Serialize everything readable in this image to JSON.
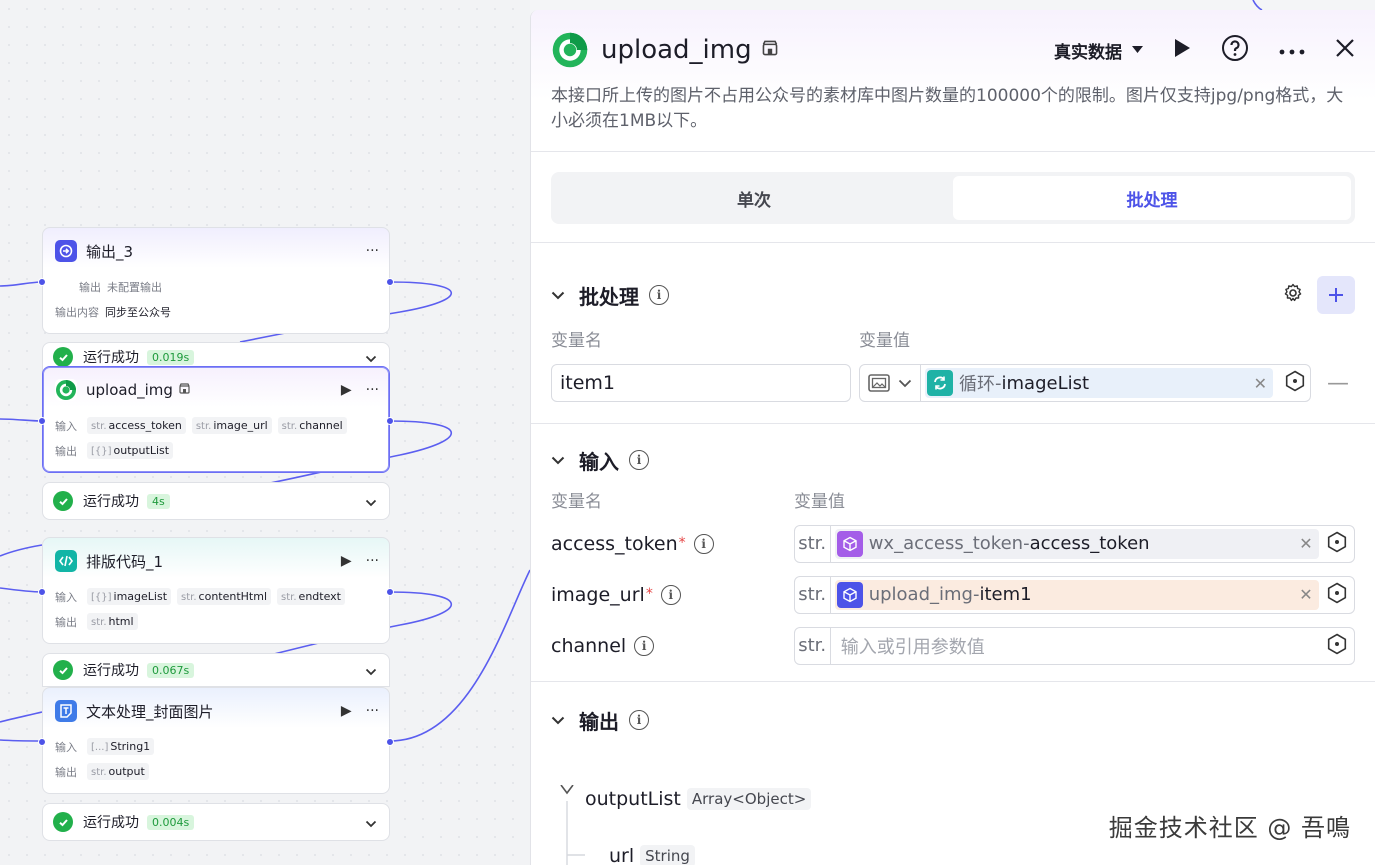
{
  "canvas": {
    "nodes": [
      {
        "title": "输出_3",
        "rows": [
          {
            "label": "输出",
            "text": "未配置输出"
          },
          {
            "label": "输出内容",
            "text": "同步至公众号"
          }
        ],
        "status": "运行成功",
        "time": "0.019s"
      },
      {
        "title": "upload_img",
        "input_label": "输入",
        "inputs": [
          {
            "type": "str.",
            "name": "access_token"
          },
          {
            "type": "str.",
            "name": "image_url"
          },
          {
            "type": "str.",
            "name": "channel"
          }
        ],
        "output_label": "输出",
        "outputs": [
          {
            "type": "[{}]",
            "name": "outputList"
          }
        ],
        "status": "运行成功",
        "time": "4s"
      },
      {
        "title": "排版代码_1",
        "input_label": "输入",
        "inputs": [
          {
            "type": "[{}]",
            "name": "imageList"
          },
          {
            "type": "str.",
            "name": "contentHtml"
          },
          {
            "type": "str.",
            "name": "endtext"
          }
        ],
        "output_label": "输出",
        "outputs": [
          {
            "type": "str.",
            "name": "html"
          }
        ],
        "status": "运行成功",
        "time": "0.067s"
      },
      {
        "title": "文本处理_封面图片",
        "input_label": "输入",
        "inputs": [
          {
            "type": "[...]",
            "name": "String1"
          }
        ],
        "output_label": "输出",
        "outputs": [
          {
            "type": "str.",
            "name": "output"
          }
        ],
        "status": "运行成功",
        "time": "0.004s"
      }
    ],
    "more_glyph": "···",
    "run_glyph": "▶"
  },
  "panel": {
    "title": "upload_img",
    "data_mode": "真实数据",
    "description": "本接口所上传的图片不占用公众号的素材库中图片数量的100000个的限制。图片仅支持jpg/png格式，大小必须在1MB以下。",
    "tabs": [
      "单次",
      "批处理"
    ],
    "active_tab": "批处理",
    "batch": {
      "title": "批处理",
      "col_name": "变量名",
      "col_value": "变量值",
      "item_name": "item1",
      "ref_source": "循环",
      "ref_sep": " - ",
      "ref_var": "imageList"
    },
    "inputs": {
      "title": "输入",
      "col_name": "变量名",
      "col_value": "变量值",
      "type_tag": "str.",
      "rows": [
        {
          "name": "access_token",
          "required": "*",
          "source": "wx_access_token",
          "var": "access_token"
        },
        {
          "name": "image_url",
          "required": "*",
          "source": "upload_img",
          "var": "item1"
        },
        {
          "name": "channel",
          "required": "",
          "placeholder": "输入或引用参数值"
        }
      ]
    },
    "outputs": {
      "title": "输出",
      "items": [
        {
          "name": "outputList",
          "type": "Array<Object>"
        },
        {
          "name": "url",
          "type": "String"
        }
      ]
    }
  },
  "watermark": "掘金技术社区 @ 吾鳴",
  "colors": {
    "accent": "#4d53e8",
    "edge": "#5b5ef0",
    "success": "#22b04b",
    "loop_icon": "#1fb2a6",
    "plugin_icon": "#7b4fe6"
  }
}
